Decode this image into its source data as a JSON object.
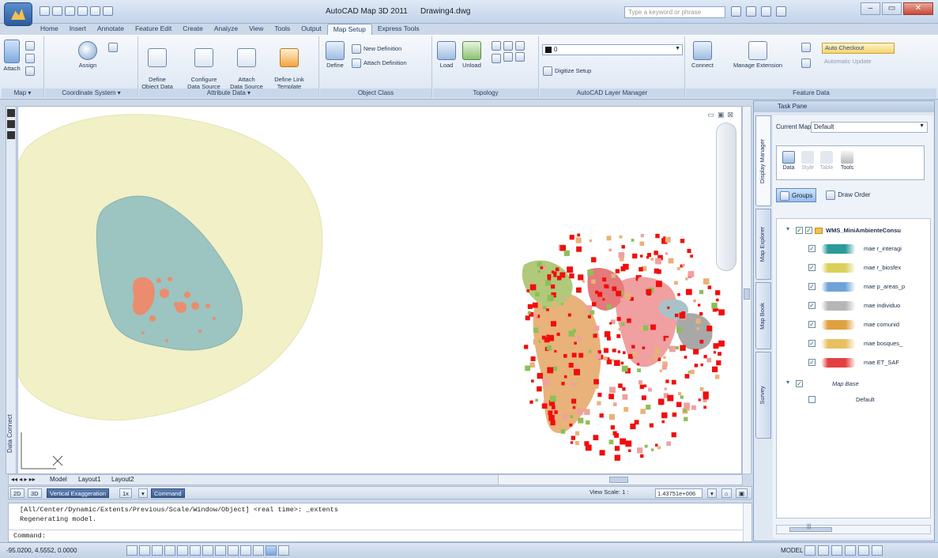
{
  "title_bar": {
    "app_title": "AutoCAD Map 3D 2011",
    "doc_title": "Drawing4.dwg",
    "search_placeholder": "Type a keyword or phrase"
  },
  "ribbon_tabs": [
    "Home",
    "Insert",
    "Annotate",
    "Feature Edit",
    "Create",
    "Analyze",
    "View",
    "Tools",
    "Output",
    "Map Setup",
    "Express Tools"
  ],
  "active_tab": "Map Setup",
  "ribbon": {
    "attach": "Attach",
    "assign": "Assign",
    "define_object_data": "Define\nObject Data",
    "configure_data_source": "Configure\nData Source",
    "attach_data_source": "Attach\nData Source",
    "define_link_template": "Define Link\nTemplate",
    "define": "Define",
    "new_definition": "New Definition",
    "attach_definition": "Attach Definition",
    "load": "Load",
    "unload": "Unload",
    "digitize_setup": "Digitize Setup",
    "layer_value": "0",
    "connect": "Connect",
    "manage_extension": "Manage Extension",
    "auto_checkout": "Auto Checkout",
    "automatic_update": "Automatic Update",
    "panels": {
      "map": "Map ▾",
      "coordinate_system": "Coordinate System ▾",
      "attribute_data": "Attribute Data ▾",
      "object_class": "Object Class",
      "topology": "Topology",
      "layer_manager": "AutoCAD Layer Manager",
      "feature_data": "Feature Data"
    }
  },
  "left_strip": {
    "data_connect": "Data Connect"
  },
  "layout_tabs": [
    "Model",
    "Layout1",
    "Layout2"
  ],
  "toolstrip": {
    "mode_2d": "2D",
    "mode_3d": "3D",
    "vertical_exaggeration": "Vertical Exaggeration",
    "exaggeration_value": "1x",
    "command": "Command",
    "view_scale_label": "View Scale: 1 :",
    "view_scale_value": "1.43751e+006"
  },
  "command_lines": [
    "[All/Center/Dynamic/Extents/Previous/Scale/Window/Object] <real time>: _extents",
    "Regenerating model.",
    "Command:"
  ],
  "status_bar": {
    "coordinates": "-95.0200, 4.5552, 0.0000",
    "model": "MODEL"
  },
  "task_pane": {
    "title": "Task Pane",
    "current_map_label": "Current Map:",
    "current_map_value": "Default",
    "vertical_tabs": [
      "Display Manager",
      "Map Explorer",
      "Map Book",
      "Survey"
    ],
    "toolbox": [
      "Data",
      "Style",
      "Table",
      "Tools"
    ],
    "groups_label": "Groups",
    "draw_order_label": "Draw Order",
    "tree_root": "WMS_MiniAmbienteConsu",
    "layers": [
      "mae r_interagi",
      "mae r_biosfex",
      "mae p_areas_p",
      "mae individuo",
      "mae comunid",
      "mae bosques_",
      "mae ET_SAF"
    ],
    "base_group": "Map Base",
    "base_item": "Default"
  },
  "colors": {
    "outer_zone": "#f1f0c6",
    "inner_zone": "#9cc4c0",
    "core_spots": "#ea8d6e",
    "feature_red": "#f20d0d",
    "feature_green": "#8cbf58",
    "feature_tan": "#e8b27a",
    "feature_pink": "#f0a0a0",
    "feature_gray": "#a8a8a8"
  }
}
